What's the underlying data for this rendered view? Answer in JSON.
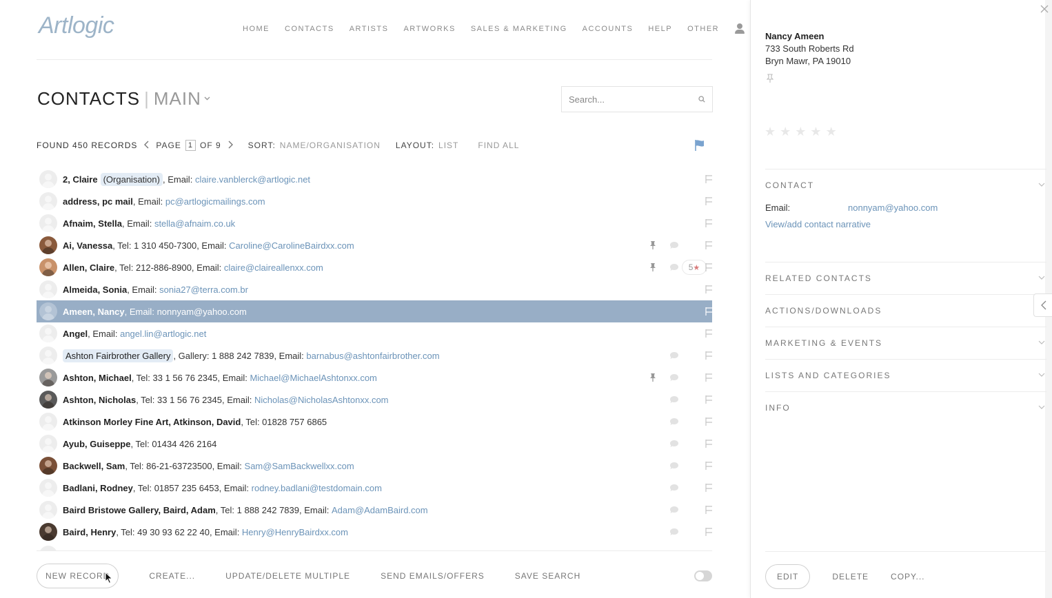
{
  "app": {
    "logo": "Artlogic"
  },
  "nav": {
    "items": [
      "HOME",
      "CONTACTS",
      "ARTISTS",
      "ARTWORKS",
      "SALES & MARKETING",
      "ACCOUNTS",
      "HELP",
      "OTHER"
    ],
    "user_icon": "user-icon"
  },
  "page": {
    "title": "CONTACTS",
    "separator": "|",
    "subtitle": "MAIN",
    "search_placeholder": "Search..."
  },
  "toolbar": {
    "found_prefix": "FOUND",
    "found_count": "450",
    "found_suffix": "RECORDS",
    "page_label": "PAGE",
    "page_current": "1",
    "page_of": "OF 9",
    "sort_label": "SORT:",
    "sort_value": "NAME/ORGANISATION",
    "layout_label": "LAYOUT:",
    "layout_value": "LIST",
    "find_all": "FIND ALL"
  },
  "rows": [
    {
      "avatar": "placeholder",
      "name": "2, Claire",
      "tag": "(Organisation)",
      "text": ", Email: ",
      "email": "claire.vanblerck@artlogic.net",
      "pin": false,
      "bubble": false,
      "rating": ""
    },
    {
      "avatar": "placeholder",
      "name": "address, pc mail",
      "text": ", Email: ",
      "email": "pc@artlogicmailings.com",
      "pin": false,
      "bubble": false,
      "rating": ""
    },
    {
      "avatar": "placeholder",
      "name": "Afnaim, Stella",
      "text": ", Email: ",
      "email": "stella@afnaim.co.uk",
      "pin": false,
      "bubble": false,
      "rating": ""
    },
    {
      "avatar": "photo",
      "avatar_color": "#8a5a3c",
      "name": "Ai, Vanessa",
      "text": ", Tel: 1 310 450-7300, Email: ",
      "email": "Caroline@CarolineBairdxx.com",
      "pin": true,
      "bubble": true,
      "rating": ""
    },
    {
      "avatar": "photo",
      "avatar_color": "#c9926a",
      "name": "Allen, Claire",
      "text": ", Tel: 212-886-8900, Email: ",
      "email": "claire@claireallenxx.com",
      "pin": true,
      "bubble": true,
      "rating": "5"
    },
    {
      "avatar": "placeholder",
      "name": "Almeida, Sonia",
      "text": ", Email: ",
      "email": "sonia27@terra.com.br",
      "pin": false,
      "bubble": false,
      "rating": ""
    },
    {
      "avatar": "placeholder",
      "name": "Ameen, Nancy",
      "text": ", Email: ",
      "email": "nonnyam@yahoo.com",
      "pin": false,
      "bubble": false,
      "rating": "",
      "selected": true
    },
    {
      "avatar": "placeholder",
      "name": "Angel",
      "text": ", Email: ",
      "email": "angel.lin@artlogic.net",
      "pin": false,
      "bubble": false,
      "rating": ""
    },
    {
      "avatar": "placeholder",
      "tagname": "Ashton Fairbrother Gallery",
      "text": ", Gallery: 1 888 242 7839, Email: ",
      "email": "barnabus@ashtonfairbrother.com",
      "pin": false,
      "bubble": true,
      "rating": ""
    },
    {
      "avatar": "photo",
      "avatar_color": "#9a9a9a",
      "name": "Ashton, Michael",
      "text": ", Tel: 33 1 56 76 2345, Email: ",
      "email": "Michael@MichaelAshtonxx.com",
      "pin": true,
      "bubble": true,
      "rating": ""
    },
    {
      "avatar": "photo",
      "avatar_color": "#5a5a5a",
      "name": "Ashton, Nicholas",
      "text": ", Tel: 33 1 56 76 2345, Email: ",
      "email": "Nicholas@NicholasAshtonxx.com",
      "pin": false,
      "bubble": true,
      "rating": ""
    },
    {
      "avatar": "placeholder",
      "name": "Atkinson Morley Fine Art, Atkinson, David",
      "text": ", Tel: 01828 757 6865",
      "email": "",
      "pin": false,
      "bubble": true,
      "rating": ""
    },
    {
      "avatar": "placeholder",
      "name": "Ayub, Guiseppe",
      "text": ", Tel: 01434 426 2164",
      "email": "",
      "pin": false,
      "bubble": true,
      "rating": ""
    },
    {
      "avatar": "photo",
      "avatar_color": "#7a5038",
      "name": "Backwell, Sam",
      "text": ", Tel: 86-21-63723500, Email: ",
      "email": "Sam@SamBackwellxx.com",
      "pin": false,
      "bubble": true,
      "rating": ""
    },
    {
      "avatar": "placeholder",
      "name": "Badlani, Rodney",
      "text": ", Tel: 01857 235 6453, Email: ",
      "email": "rodney.badlani@testdomain.com",
      "pin": false,
      "bubble": true,
      "rating": ""
    },
    {
      "avatar": "placeholder",
      "name": "Baird Bristowe Gallery, Baird, Adam",
      "text": ", Tel: 1 888 242 7839, Email: ",
      "email": "Adam@AdamBaird.com",
      "pin": false,
      "bubble": true,
      "rating": ""
    },
    {
      "avatar": "photo",
      "avatar_color": "#4a3a30",
      "name": "Baird, Henry",
      "text": ", Tel: 49 30 93 62 22 40, Email: ",
      "email": "Henry@HenryBairdxx.com",
      "pin": false,
      "bubble": true,
      "rating": ""
    }
  ],
  "footer": {
    "new_record": "NEW RECORD",
    "create": "CREATE...",
    "update_delete": "UPDATE/DELETE MULTIPLE",
    "send_emails": "SEND EMAILS/OFFERS",
    "save_search": "SAVE SEARCH"
  },
  "panel": {
    "name": "Nancy Ameen",
    "address_line1": "733 South Roberts Rd",
    "address_line2": "Bryn Mawr, PA 19010",
    "stars": [
      "★",
      "★",
      "★",
      "★",
      "★"
    ],
    "sections": [
      "CONTACT",
      "RELATED CONTACTS",
      "ACTIONS/DOWNLOADS",
      "MARKETING & EVENTS",
      "LISTS AND CATEGORIES",
      "INFO"
    ],
    "email_label": "Email:",
    "email_value": "nonnyam@yahoo.com",
    "narrative_link": "View/add contact narrative",
    "edit": "EDIT",
    "delete": "DELETE",
    "copy": "COPY..."
  },
  "colors": {
    "accent": "#6b93b8",
    "selected_row": "#98aec6",
    "flag_active": "#7aa3cf"
  }
}
